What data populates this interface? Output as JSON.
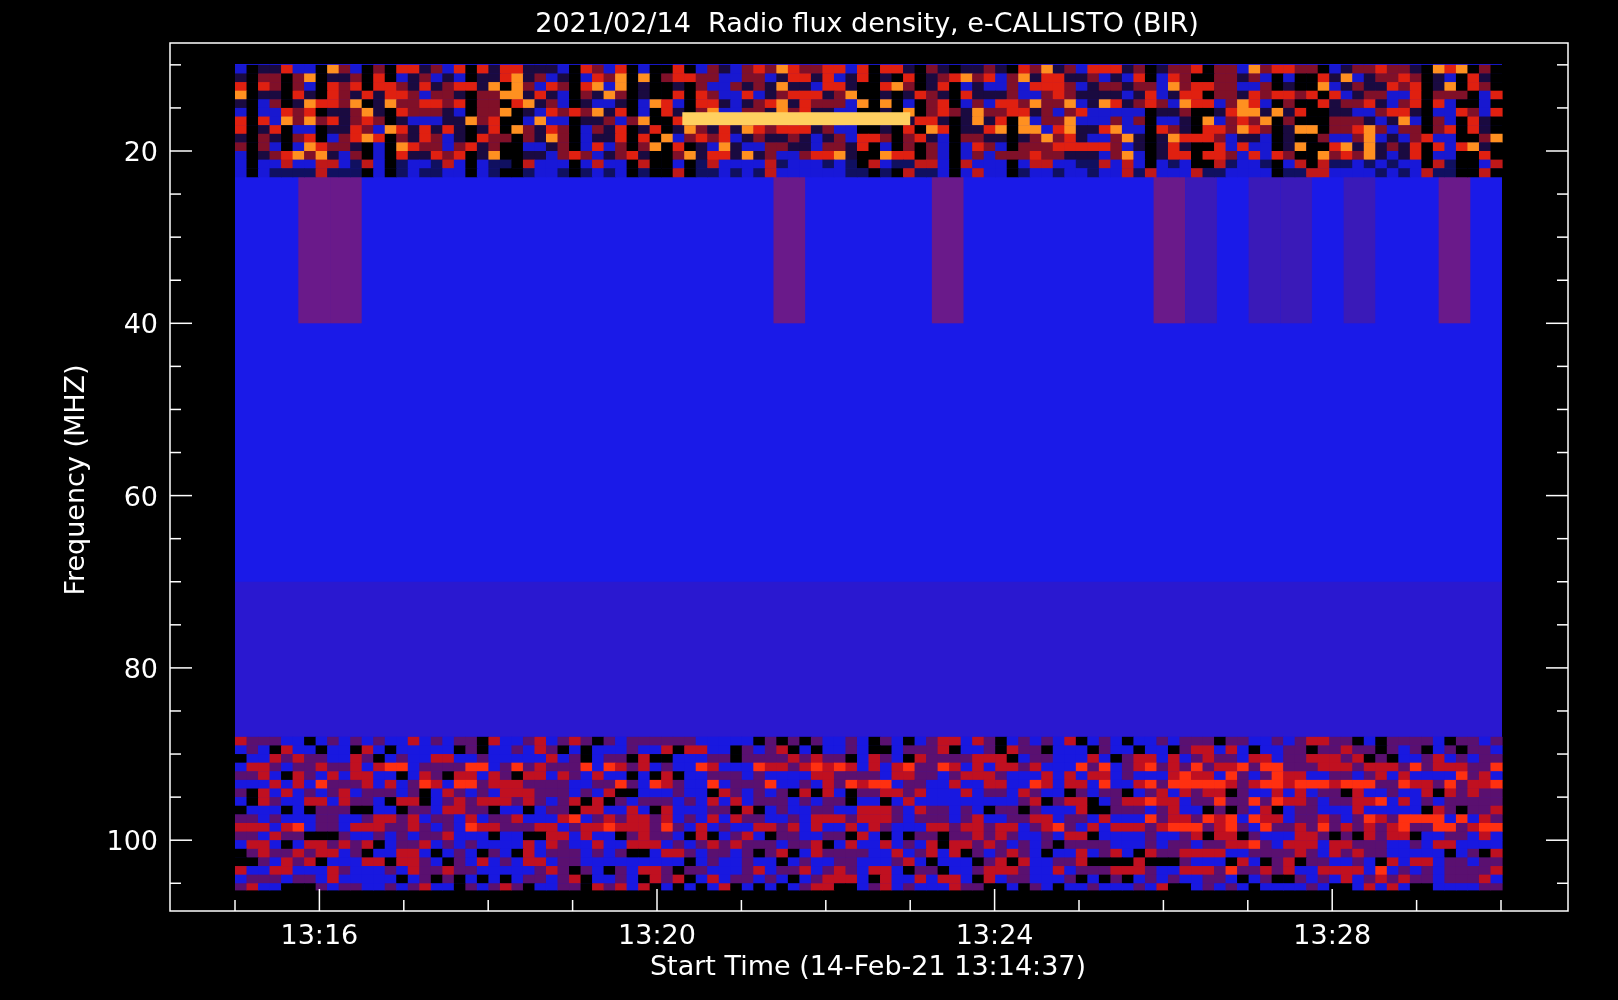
{
  "title": "2021/02/14  Radio flux density, e-CALLISTO (BIR)",
  "y_axis": {
    "label": "Frequency (MHZ)",
    "ticks": [
      "20",
      "40",
      "60",
      "80",
      "100"
    ]
  },
  "x_axis": {
    "label": "Start Time (14-Feb-21 13:14:37)",
    "ticks": [
      "13:16",
      "13:20",
      "13:24",
      "13:28"
    ]
  }
}
